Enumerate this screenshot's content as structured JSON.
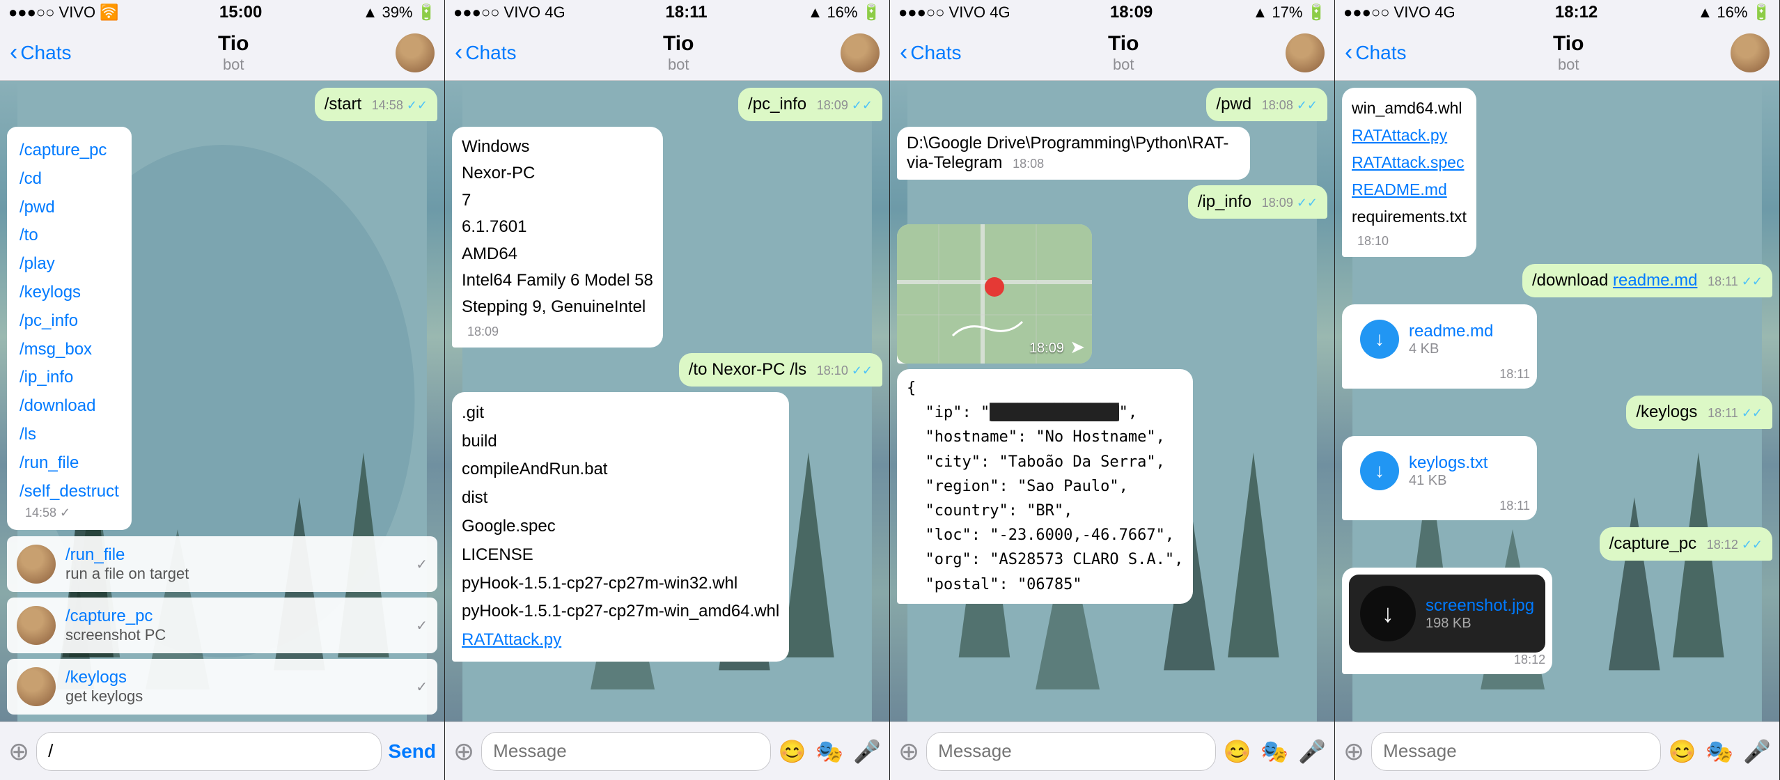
{
  "panels": [
    {
      "id": "panel1",
      "statusBar": {
        "left": "●●●○○ VIVO",
        "signal": "▶",
        "time": "15:00",
        "battery": "39%",
        "right": "↑"
      },
      "nav": {
        "back": "Chats",
        "title": "Tio",
        "subtitle": "bot"
      },
      "messages": [
        {
          "type": "sent",
          "text": "/start",
          "time": "14:58",
          "checks": "✓✓"
        },
        {
          "type": "received-menu",
          "items": [
            "/capture_pc",
            "/cd",
            "/pwd",
            "/to",
            "/play",
            "/keylogs",
            "/pc_info",
            "/msg_box",
            "/ip_info",
            "/download",
            "/ls",
            "/run_file",
            "/self_destruct"
          ],
          "time": "14:58"
        }
      ],
      "chatList": [
        {
          "title": "/run_file",
          "sub": "run a file on target"
        },
        {
          "title": "/capture_pc",
          "sub": "screenshot PC"
        },
        {
          "title": "/keylogs",
          "sub": "get keylogs"
        }
      ],
      "input": {
        "placeholder": "/",
        "value": "/",
        "send": "Send"
      }
    },
    {
      "id": "panel2",
      "statusBar": {
        "left": "●●●○○ VIVO 4G",
        "time": "18:11",
        "battery": "16%"
      },
      "nav": {
        "back": "Chats",
        "title": "Tio",
        "subtitle": "bot"
      },
      "messages": [
        {
          "type": "sent",
          "text": "/pc_info",
          "time": "18:09",
          "checks": "✓✓"
        },
        {
          "type": "received-pc",
          "lines": [
            "Windows",
            "Nexor-PC",
            "7",
            "6.1.7601",
            "AMD64",
            "Intel64 Family 6 Model 58",
            "Stepping 9, GenuineIntel"
          ],
          "time": "18:09"
        },
        {
          "type": "sent",
          "text": "/to Nexor-PC /ls",
          "time": "18:10",
          "checks": "✓✓"
        },
        {
          "type": "received-ls",
          "items": [
            ".git",
            "build",
            "compileAndRun.bat",
            "dist",
            "Google.spec",
            "LICENSE",
            "pyHook-1.5.1-cp27-cp27m-win32.whl",
            "pyHook-1.5.1-cp27-cp27m-win_amd64.whl",
            "RATAttack.py"
          ],
          "time": ""
        }
      ],
      "input": {
        "placeholder": "Message"
      }
    },
    {
      "id": "panel3",
      "statusBar": {
        "left": "●●●○○ VIVO 4G",
        "time": "18:09",
        "battery": "17%"
      },
      "nav": {
        "back": "Chats",
        "title": "Tio",
        "subtitle": "bot"
      },
      "messages": [
        {
          "type": "sent",
          "text": "/pwd",
          "time": "18:08",
          "checks": "✓✓"
        },
        {
          "type": "received-path",
          "text": "D:\\Google Drive\\Programming\\Python\\RAT-via-Telegram",
          "time": "18:08"
        },
        {
          "type": "sent",
          "text": "/ip_info",
          "time": "18:09",
          "checks": "✓✓"
        },
        {
          "type": "map",
          "time": "18:09"
        },
        {
          "type": "received-json",
          "lines": [
            "{",
            "  \"ip\": \"███████████████\",",
            "  \"hostname\": \"No Hostname\",",
            "  \"city\": \"Taboão Da Serra\",",
            "  \"region\": \"Sao Paulo\",",
            "  \"country\": \"BR\",",
            "  \"loc\": \"-23.6000,-46.7667\",",
            "  \"org\": \"AS28573 CLARO S.A.\",",
            "  \"postal\": \"06785\""
          ]
        }
      ],
      "input": {
        "placeholder": "Message"
      }
    },
    {
      "id": "panel4",
      "statusBar": {
        "left": "●●●○○ VIVO 4G",
        "time": "18:12",
        "battery": "16%"
      },
      "nav": {
        "back": "Chats",
        "title": "Tio",
        "subtitle": "bot"
      },
      "messages": [
        {
          "type": "received-files",
          "files": [
            "win_amd64.whl",
            "RATAttack.py",
            "RATAttack.spec",
            "README.md",
            "requirements.txt"
          ],
          "linkFiles": [
            "RATAttack.py",
            "RATAttack.spec",
            "README.md"
          ],
          "time": "18:10"
        },
        {
          "type": "sent",
          "text": "/download readme.md",
          "link": "readme.md",
          "time": "18:11",
          "checks": "✓✓"
        },
        {
          "type": "received-download",
          "name": "readme.md",
          "size": "4 KB",
          "time": "18:11"
        },
        {
          "type": "sent",
          "text": "/keylogs",
          "time": "18:11",
          "checks": "✓✓"
        },
        {
          "type": "received-download",
          "name": "keylogs.txt",
          "size": "41 KB",
          "time": "18:11"
        },
        {
          "type": "sent",
          "text": "/capture_pc",
          "time": "18:12",
          "checks": "✓✓"
        },
        {
          "type": "received-screenshot",
          "name": "screenshot.jpg",
          "size": "198 KB",
          "time": "18:12"
        }
      ],
      "input": {
        "placeholder": "Message"
      }
    }
  ]
}
